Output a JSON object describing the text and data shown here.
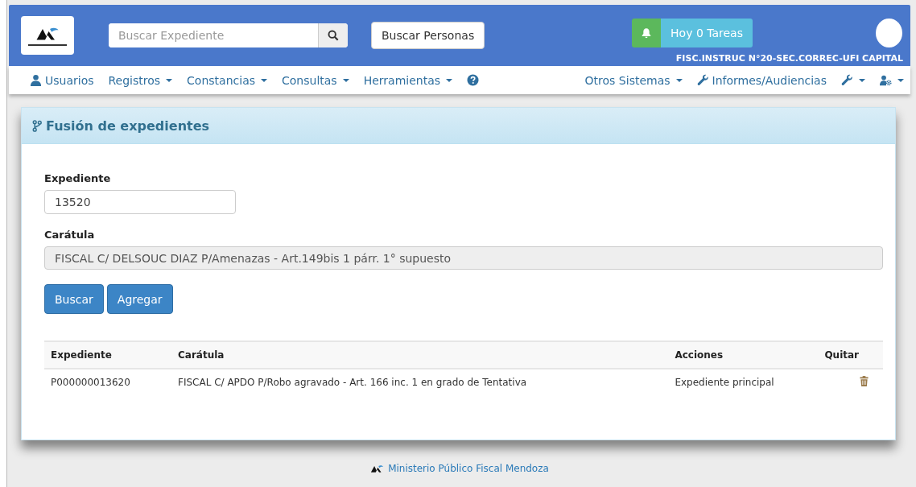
{
  "header": {
    "search": {
      "placeholder": "Buscar Expediente"
    },
    "people_button": "Buscar Personas",
    "tasks_button": "Hoy 0 Tareas",
    "office": "FISC.INSTRUC N°20-SEC.CORREC-UFI CAPITAL"
  },
  "nav_left": [
    {
      "kind": "user",
      "label": "Usuarios",
      "caret": false
    },
    {
      "kind": "plain",
      "label": "Registros",
      "caret": true
    },
    {
      "kind": "plain",
      "label": "Constancias",
      "caret": true
    },
    {
      "kind": "plain",
      "label": "Consultas",
      "caret": true
    },
    {
      "kind": "plain",
      "label": "Herramientas",
      "caret": true
    },
    {
      "kind": "help",
      "caret": false
    }
  ],
  "nav_right": [
    {
      "kind": "plain",
      "label": "Otros Sistemas",
      "caret": true
    },
    {
      "kind": "wrench",
      "label": "Informes/Audiencias",
      "caret": false
    },
    {
      "kind": "wrench",
      "caret": true
    },
    {
      "kind": "user-gear",
      "caret": true
    }
  ],
  "panel": {
    "title": "Fusión de expedientes",
    "fields": [
      {
        "kind": "input",
        "label": "Expediente",
        "value": "13520"
      },
      {
        "kind": "readonly",
        "label": "Carátula",
        "value": "FISCAL C/ DELSOUC DIAZ P/Amenazas - Art.149bis 1 párr. 1° supuesto"
      }
    ],
    "buttons": [
      "Buscar",
      "Agregar"
    ],
    "table": {
      "columns": [
        "Expediente",
        "Carátula",
        "Acciones",
        "Quitar"
      ],
      "rows": [
        {
          "expediente": "P000000013620",
          "caratula": "FISCAL C/ APDO P/Robo agravado - Art. 166 inc. 1 en grado de Tentativa",
          "acciones": "Expediente principal"
        }
      ]
    }
  },
  "footer": "Ministerio Público Fiscal Mendoza"
}
